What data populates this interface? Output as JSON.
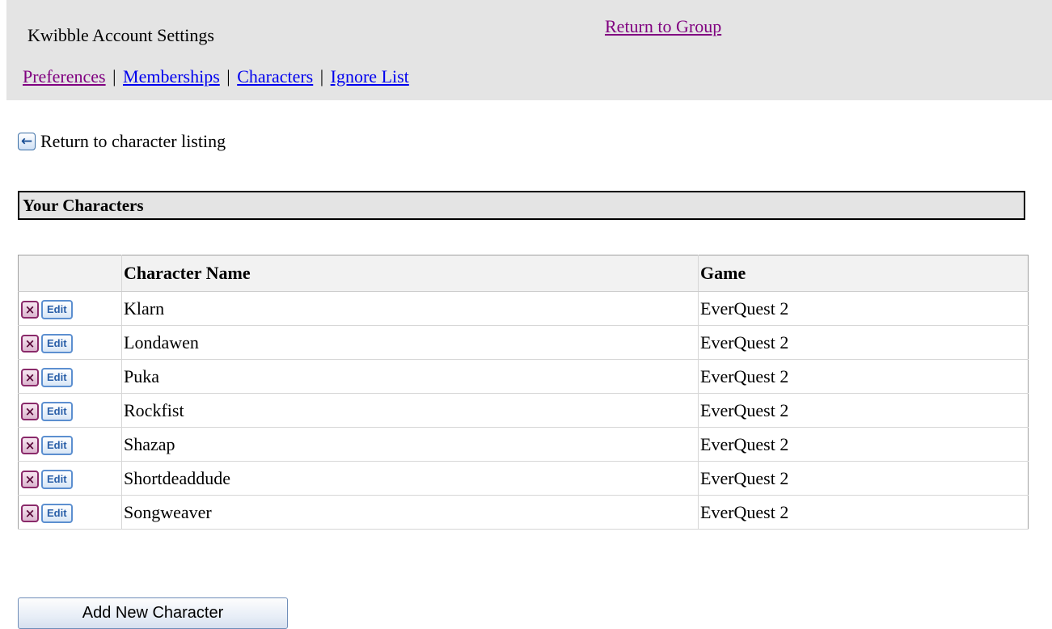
{
  "header": {
    "title": "Kwibble Account Settings",
    "return_to_group": "Return to Group",
    "nav": {
      "preferences": "Preferences",
      "memberships": "Memberships",
      "characters": "Characters",
      "ignore_list": "Ignore List",
      "separator": "|"
    }
  },
  "back_link": {
    "icon": "back-arrow-icon",
    "label": "Return to character listing"
  },
  "section": {
    "title": "Your Characters"
  },
  "table": {
    "columns": [
      "",
      "Character Name",
      "Game"
    ],
    "rows": [
      {
        "name": "Klarn",
        "game": "EverQuest 2"
      },
      {
        "name": "Londawen",
        "game": "EverQuest 2"
      },
      {
        "name": "Puka",
        "game": "EverQuest 2"
      },
      {
        "name": "Rockfist",
        "game": "EverQuest 2"
      },
      {
        "name": "Shazap",
        "game": "EverQuest 2"
      },
      {
        "name": "Shortdeaddude",
        "game": "EverQuest 2"
      },
      {
        "name": "Songweaver",
        "game": "EverQuest 2"
      }
    ],
    "delete_icon": "×",
    "edit_label": "Edit"
  },
  "add_button": {
    "label": "Add New Character"
  },
  "colors": {
    "header_bg": "#e4e4e4",
    "link": "#0000ee",
    "visited_link": "#800080",
    "delete_border": "#8a2a6a",
    "edit_border": "#5c8fd0"
  }
}
